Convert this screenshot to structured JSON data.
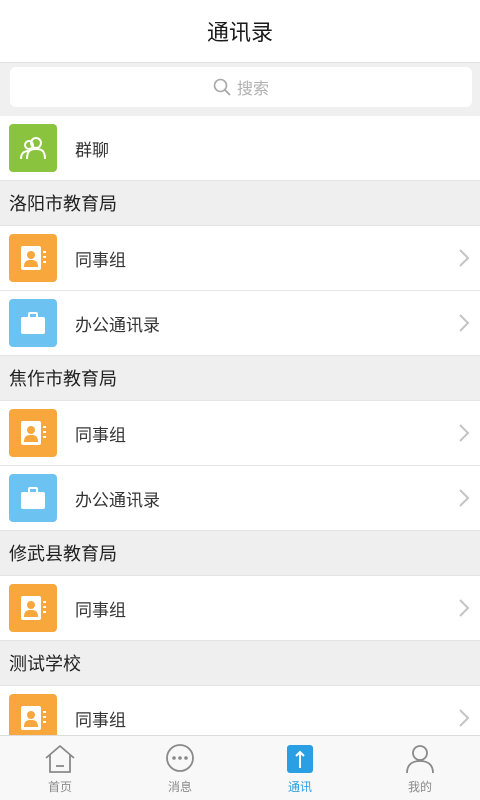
{
  "header": {
    "title": "通讯录"
  },
  "search": {
    "placeholder": "搜索"
  },
  "group_chat": {
    "label": "群聊"
  },
  "sections": [
    {
      "title": "洛阳市教育局",
      "items": [
        {
          "label": "同事组",
          "icon": "colleague-icon"
        },
        {
          "label": "办公通讯录",
          "icon": "briefcase-icon"
        }
      ]
    },
    {
      "title": "焦作市教育局",
      "items": [
        {
          "label": "同事组",
          "icon": "colleague-icon"
        },
        {
          "label": "办公通讯录",
          "icon": "briefcase-icon"
        }
      ]
    },
    {
      "title": "修武县教育局",
      "items": [
        {
          "label": "同事组",
          "icon": "colleague-icon"
        }
      ]
    },
    {
      "title": "测试学校",
      "items": [
        {
          "label": "同事组",
          "icon": "colleague-icon"
        }
      ]
    }
  ],
  "tabs": [
    {
      "label": "首页",
      "icon": "home-icon"
    },
    {
      "label": "消息",
      "icon": "message-icon"
    },
    {
      "label": "通讯",
      "icon": "contacts-icon",
      "active": true
    },
    {
      "label": "我的",
      "icon": "profile-icon"
    }
  ],
  "colors": {
    "green": "#8ac43f",
    "orange": "#f7a73b",
    "blue": "#6cc3f2",
    "accent": "#2a9fe3"
  }
}
